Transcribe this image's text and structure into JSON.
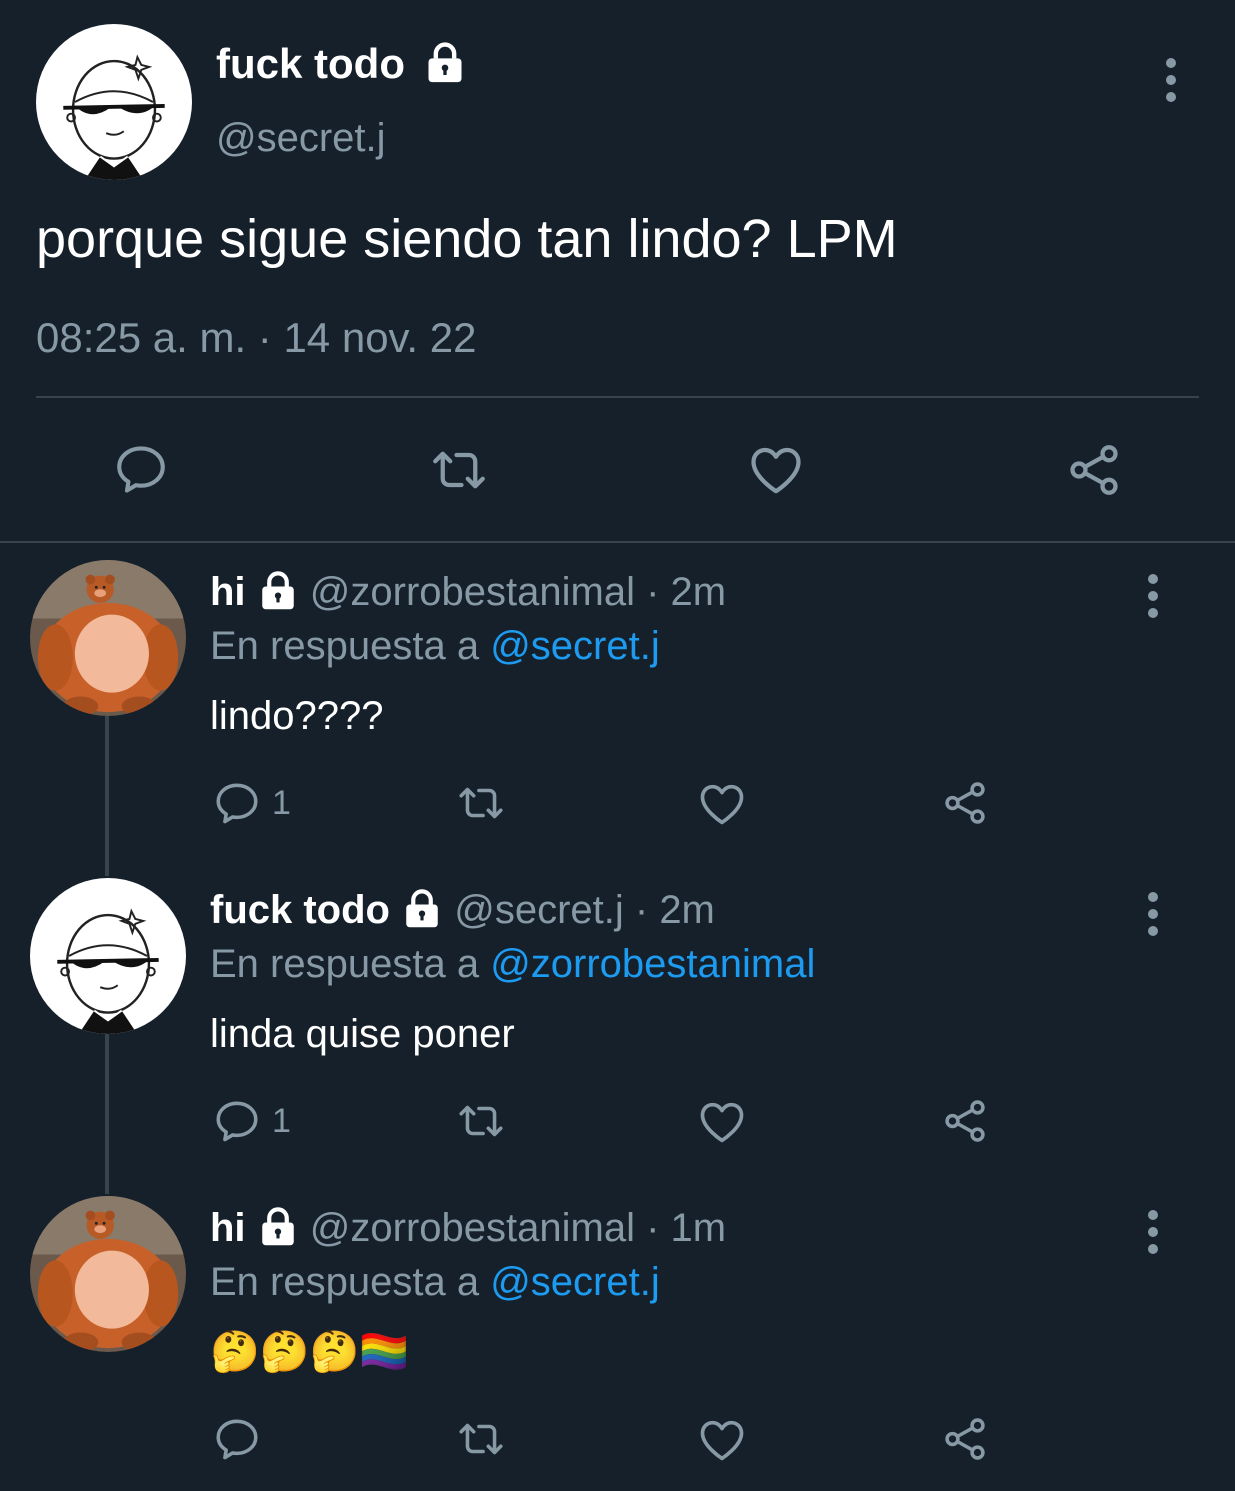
{
  "main_tweet": {
    "display_name": "fuck todo",
    "handle": "@secret.j",
    "text": "porque sigue siendo tan lindo? LPM",
    "timestamp": "08:25 a. m. · 14 nov. 22"
  },
  "icons": {
    "lock": "lock-icon",
    "reply": "reply-icon",
    "retweet": "retweet-icon",
    "like": "heart-icon",
    "share": "share-icon",
    "more": "more-vertical-icon"
  },
  "colors": {
    "background": "#15202b",
    "muted": "#8899a6",
    "link": "#1d9bf0",
    "divider": "#38444d"
  },
  "replies": [
    {
      "display_name": "hi",
      "handle": "@zorrobestanimal",
      "time": " · 2m",
      "reply_prefix": "En respuesta a ",
      "reply_to": "@secret.j",
      "text": "lindo????",
      "reply_count": "1"
    },
    {
      "display_name": "fuck todo",
      "handle": "@secret.j",
      "time": " · 2m",
      "reply_prefix": "En respuesta a ",
      "reply_to": "@zorrobestanimal",
      "text": "linda quise poner",
      "reply_count": "1"
    },
    {
      "display_name": "hi",
      "handle": "@zorrobestanimal",
      "time": " · 1m",
      "reply_prefix": "En respuesta a ",
      "reply_to": "@secret.j",
      "text": "🤔🤔🤔🏳️‍🌈",
      "reply_count": ""
    }
  ]
}
